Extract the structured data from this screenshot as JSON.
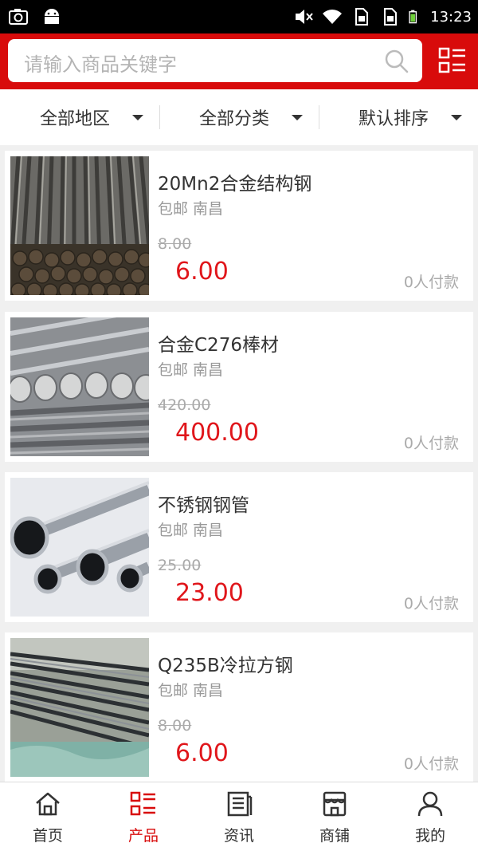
{
  "status_bar": {
    "time": "13:23",
    "icons": [
      "screenshot-icon",
      "android-icon",
      "mute-icon",
      "wifi-icon",
      "sim1-icon",
      "sim2-icon",
      "battery-icon"
    ]
  },
  "search": {
    "placeholder": "请输入商品关键字"
  },
  "filters": [
    {
      "label": "全部地区"
    },
    {
      "label": "全部分类"
    },
    {
      "label": "默认排序"
    }
  ],
  "products": [
    {
      "title": "20Mn2合金结构钢",
      "sub": "包邮 南昌",
      "old_price": "8.00",
      "price": "6.00",
      "paid": "0人付款",
      "image": "steel-rods-photo"
    },
    {
      "title": "合金C276棒材",
      "sub": "包邮 南昌",
      "old_price": "420.00",
      "price": "400.00",
      "paid": "0人付款",
      "image": "alloy-bars-photo"
    },
    {
      "title": "不锈钢钢管",
      "sub": "包邮 南昌",
      "old_price": "25.00",
      "price": "23.00",
      "paid": "0人付款",
      "image": "stainless-pipes-photo"
    },
    {
      "title": "Q235B冷拉方钢",
      "sub": "包邮 南昌",
      "old_price": "8.00",
      "price": "6.00",
      "paid": "0人付款",
      "image": "square-steel-photo"
    }
  ],
  "bottom_nav": [
    {
      "label": "首页",
      "icon": "home-icon",
      "active": false
    },
    {
      "label": "产品",
      "icon": "product-grid-icon",
      "active": true
    },
    {
      "label": "资讯",
      "icon": "news-icon",
      "active": false
    },
    {
      "label": "商铺",
      "icon": "shop-icon",
      "active": false
    },
    {
      "label": "我的",
      "icon": "user-icon",
      "active": false
    }
  ],
  "colors": {
    "brand": "#d80b0b",
    "price": "#e0161b"
  }
}
